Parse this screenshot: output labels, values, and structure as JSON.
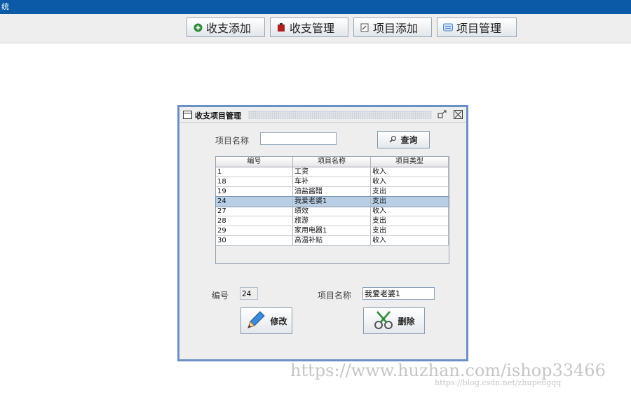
{
  "window": {
    "title": "统"
  },
  "toolbar": {
    "buttons": [
      {
        "label": "收支添加",
        "icon": "add-circle-icon",
        "color": "#2e8b3a"
      },
      {
        "label": "收支管理",
        "icon": "ledger-icon",
        "color": "#b02020"
      },
      {
        "label": "项目添加",
        "icon": "edit-note-icon",
        "color": "#555555"
      },
      {
        "label": "项目管理",
        "icon": "list-icon",
        "color": "#4a86c8"
      }
    ]
  },
  "frame": {
    "title": "收支项目管理",
    "search": {
      "label": "项目名称",
      "value": "",
      "button": "查询"
    },
    "table": {
      "headers": [
        "编号",
        "项目名称",
        "项目类型"
      ],
      "rows": [
        [
          "1",
          "工资",
          "收入"
        ],
        [
          "18",
          "车补",
          "收入"
        ],
        [
          "19",
          "油盐酱醋",
          "支出"
        ],
        [
          "24",
          "我爱老婆1",
          "支出"
        ],
        [
          "27",
          "绩效",
          "收入"
        ],
        [
          "28",
          "旅游",
          "支出"
        ],
        [
          "29",
          "家用电器1",
          "支出"
        ],
        [
          "30",
          "高温补贴",
          "收入"
        ]
      ],
      "selected_index": 3
    },
    "detail": {
      "id_label": "编号",
      "id_value": "24",
      "name_label": "项目名称",
      "name_value": "我爱老婆1"
    },
    "actions": {
      "edit": "修改",
      "delete": "删除"
    }
  },
  "watermark": {
    "main": "https://www.huzhan.com/ishop33466",
    "sub": "https://blog.csdn.net/zhupengqq"
  }
}
